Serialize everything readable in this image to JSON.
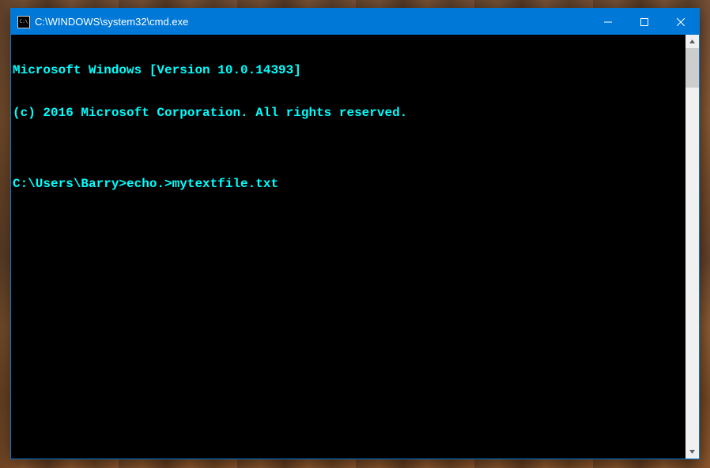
{
  "window": {
    "title": "C:\\WINDOWS\\system32\\cmd.exe"
  },
  "console": {
    "lines": [
      "Microsoft Windows [Version 10.0.14393]",
      "(c) 2016 Microsoft Corporation. All rights reserved.",
      "",
      "C:\\Users\\Barry>echo.>mytextfile.txt"
    ]
  }
}
